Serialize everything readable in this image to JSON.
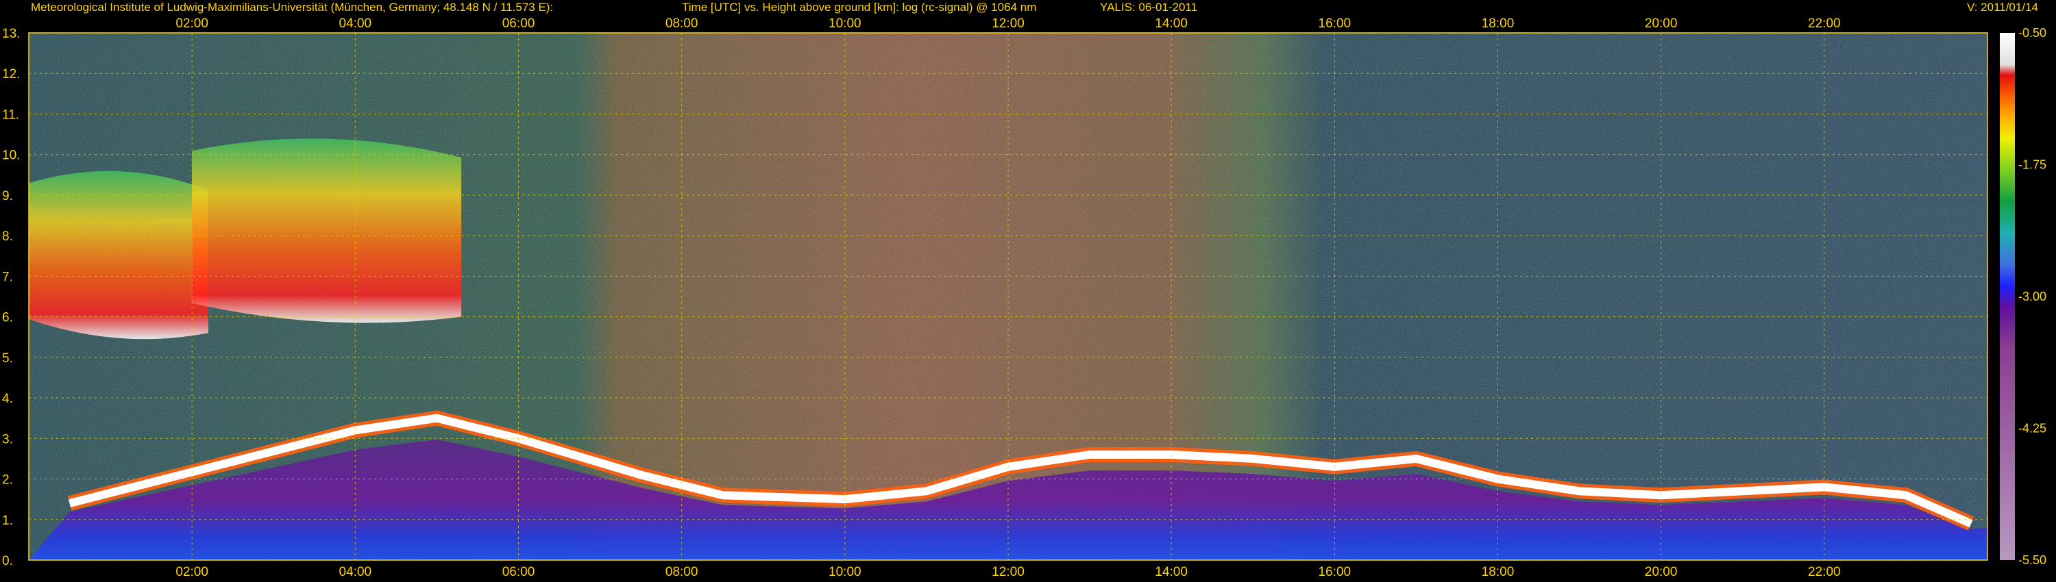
{
  "header": {
    "institute": "Meteorological Institute of Ludwig-Maximilians-Universität (München, Germany; 48.148 N / 11.573 E):",
    "plot_description": "Time [UTC] vs. Height above ground [km]: log (rc-signal) @ 1064 nm",
    "instrument_date": "YALIS: 06-01-2011",
    "version": "V: 2011/01/14"
  },
  "chart_data": {
    "type": "heatmap",
    "x_ticks": [
      "02:00",
      "04:00",
      "06:00",
      "08:00",
      "10:00",
      "12:00",
      "14:00",
      "16:00",
      "18:00",
      "20:00",
      "22:00"
    ],
    "x_tick_hours": [
      2,
      4,
      6,
      8,
      10,
      12,
      14,
      16,
      18,
      20,
      22
    ],
    "xlim_hours": [
      0,
      24
    ],
    "y_ticks": [
      "0.",
      "1.",
      "2.",
      "3.",
      "4.",
      "5.",
      "6.",
      "7.",
      "8.",
      "9.",
      "10.",
      "11.",
      "12.",
      "13."
    ],
    "ylim": [
      0,
      13
    ],
    "grid": true,
    "colorbar": {
      "ticks": [
        "-0.50",
        "-1.75",
        "-3.00",
        "-4.25",
        "-5.50"
      ],
      "range": [
        -5.5,
        -0.5
      ]
    },
    "features": {
      "boundary_layer_top_km": [
        [
          0.5,
          1.4
        ],
        [
          4.0,
          3.2
        ],
        [
          5.0,
          3.5
        ],
        [
          6.0,
          3.0
        ],
        [
          7.5,
          2.1
        ],
        [
          8.5,
          1.6
        ],
        [
          10.0,
          1.5
        ],
        [
          11.0,
          1.7
        ],
        [
          12.0,
          2.3
        ],
        [
          13.0,
          2.6
        ],
        [
          14.0,
          2.6
        ],
        [
          15.0,
          2.5
        ],
        [
          16.0,
          2.3
        ],
        [
          17.0,
          2.5
        ],
        [
          18.0,
          2.0
        ],
        [
          19.0,
          1.7
        ],
        [
          20.0,
          1.6
        ],
        [
          21.0,
          1.7
        ],
        [
          22.0,
          1.8
        ],
        [
          23.0,
          1.6
        ],
        [
          23.8,
          0.9
        ]
      ],
      "cirrus_clouds": [
        {
          "start_hour": 0.0,
          "end_hour": 2.2,
          "bottom_km": 5.6,
          "top_km": 9.8
        },
        {
          "start_hour": 2.0,
          "end_hour": 5.3,
          "bottom_km": 6.0,
          "top_km": 10.6
        }
      ],
      "high_background_hours": [
        7.3,
        15.3
      ]
    }
  }
}
